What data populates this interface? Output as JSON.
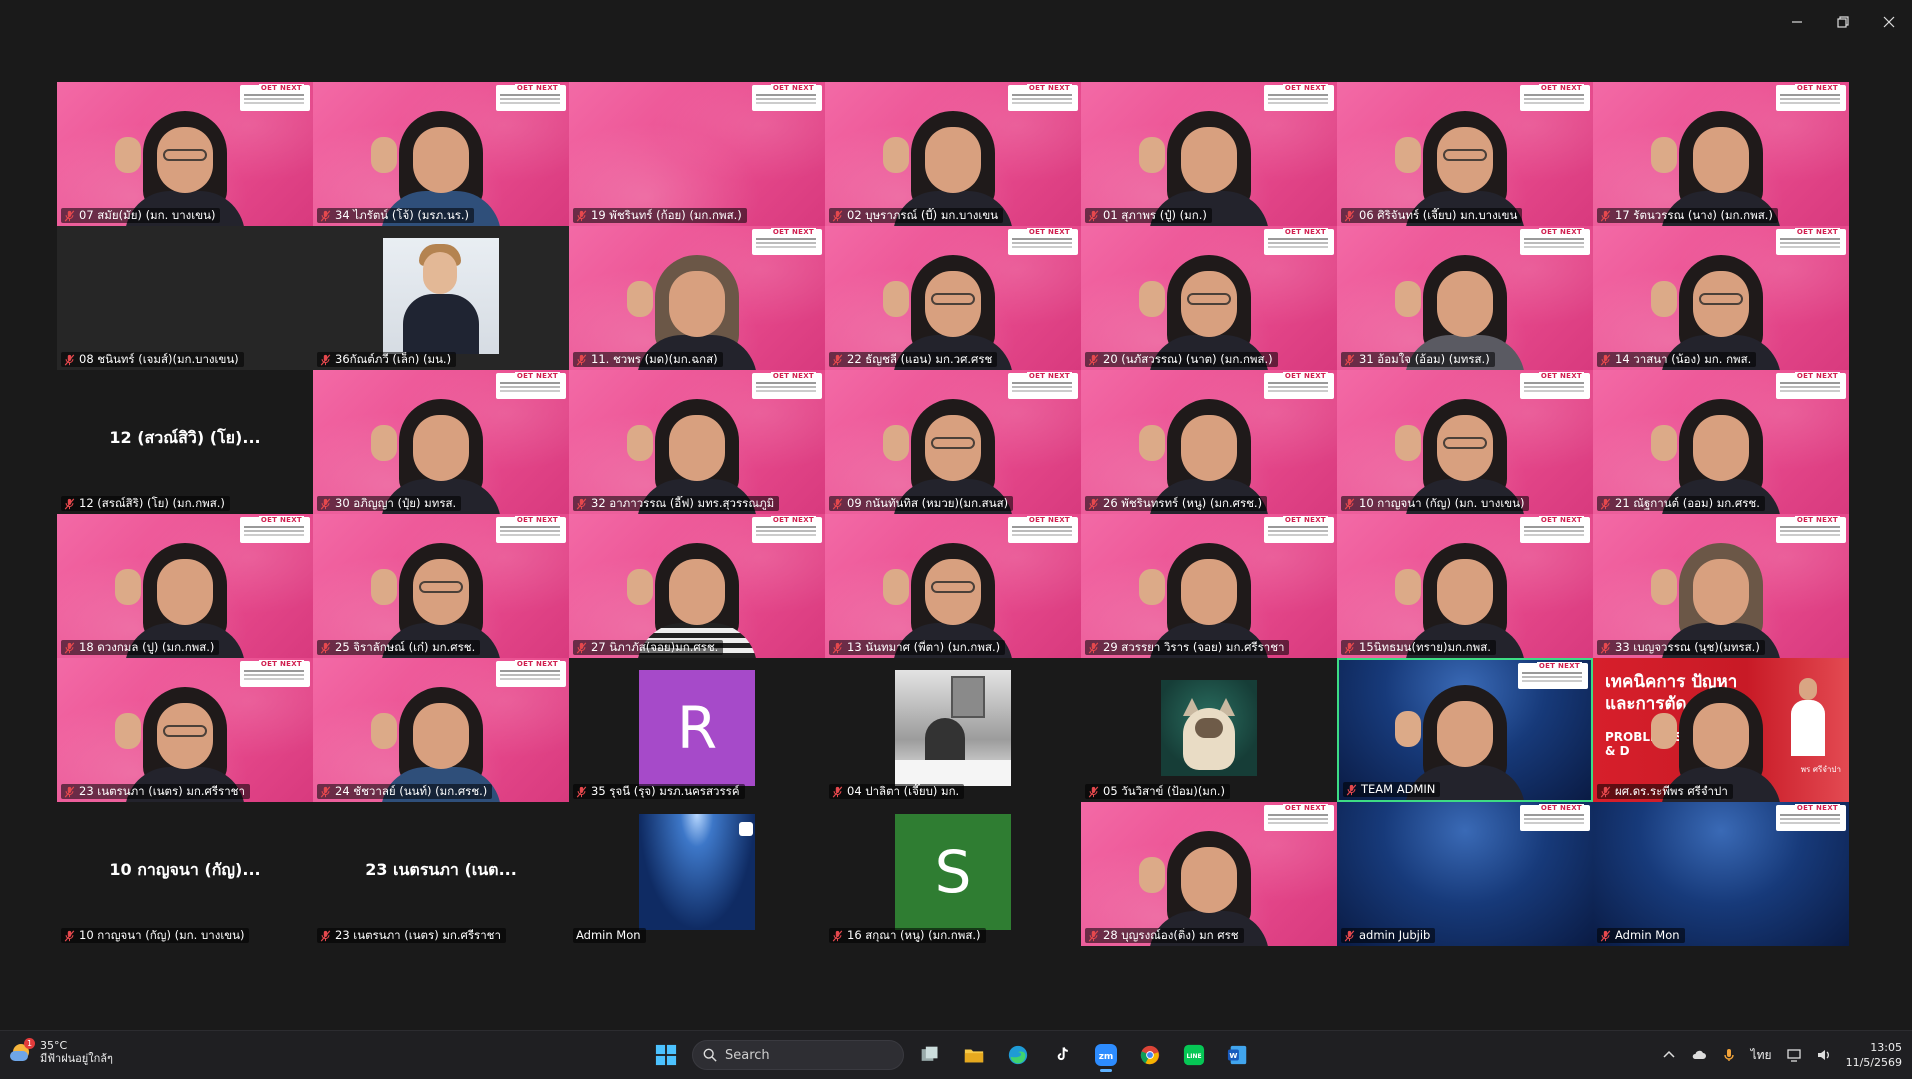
{
  "window": {
    "minimize": "minimize",
    "maximize": "restore",
    "close": "close"
  },
  "banner_logo": "OET NEXT",
  "tiles": [
    {
      "name": "07 สมัย(มัย) (มก. บางเขน)",
      "bg": "pink",
      "person": "glasses"
    },
    {
      "name": "34 ไภรัตน์ (โจ้) (มรภ.นร.)",
      "bg": "pink",
      "person": "blue-shirt"
    },
    {
      "name": "19 พัชรินทร์ (ก้อย) (มก.กพส.)",
      "bg": "pink",
      "person": "none"
    },
    {
      "name": "02 บุษราภรณ์ (บี๊) มก.บางเขน",
      "bg": "pink",
      "person": "plain"
    },
    {
      "name": "01 สุภาพร (ปู๋) (มก.)",
      "bg": "pink",
      "person": "plain"
    },
    {
      "name": "06 ศิริจันทร์ (เจี๊ยบ) มก.บางเขน",
      "bg": "pink",
      "person": "glasses"
    },
    {
      "name": "17 รัตนวรรณ (นาง) (มก.กพส.)",
      "bg": "pink",
      "person": "plain"
    },
    {
      "name": "08 ชนินทร์ (เจมส์)(มก.บางเขน)",
      "bg": "dark",
      "person": "none"
    },
    {
      "name": "36กัณต์ภวี (เล็ก) (มน.)",
      "bg": "dark",
      "avatar": "photo-man"
    },
    {
      "name": "11. ชวพร (มด)(มก.ฉกส)",
      "bg": "pink",
      "person": "light-hair"
    },
    {
      "name": "22  ธัญชลี (แอน) มก.วศ.ศรช",
      "bg": "pink",
      "person": "glasses"
    },
    {
      "name": "20 (นภัสวรรณ) (นาต) (มก.กพส.)",
      "bg": "pink",
      "person": "glasses"
    },
    {
      "name": "31 อ้อมใจ (อ้อม) (มทรส.)",
      "bg": "pink",
      "person": "gray-shirt"
    },
    {
      "name": "14 วาสนา (น้อง) มก. กพส.",
      "bg": "pink",
      "person": "glasses"
    },
    {
      "name": "12 (สรณ์สิริ) (โย) (มก.กพส.)",
      "bg": "black",
      "big": "12 (สวณ์สิวิ) (โย)..."
    },
    {
      "name": "30 อภิญญา (ปุ๋ย) มทรส.",
      "bg": "pink",
      "person": "plain"
    },
    {
      "name": "32 อาภาวรรณ (อี๊ฟ) มทร.สุวรรณภูมิ",
      "bg": "pink",
      "person": "plain"
    },
    {
      "name": "09 กนันทันทิส (หมวย)(มก.สนส)",
      "bg": "pink",
      "person": "glasses"
    },
    {
      "name": "26 พัชรินทรทร์ (หนู) (มก.ศรช.)",
      "bg": "pink",
      "person": "plain"
    },
    {
      "name": "10 กาญจนา (กัญ) (มก. บางเขน)",
      "bg": "pink",
      "person": "glasses"
    },
    {
      "name": "21 ณัฐกานต์ (ออม) มก.ศรช.",
      "bg": "pink",
      "person": "plain"
    },
    {
      "name": "18 ดวงกมล (ปู) (มก.กพส.)",
      "bg": "pink",
      "person": "plain"
    },
    {
      "name": "25 จิราลักษณ์ (เก๋) มก.ศรช.",
      "bg": "pink",
      "person": "glasses"
    },
    {
      "name": "27 นิภาภัส(จอย)มก.ศรช.",
      "bg": "pink",
      "person": "stripe"
    },
    {
      "name": "13 นันทมาศ (พี่ตา) (มก.กพส.)",
      "bg": "pink",
      "person": "glasses"
    },
    {
      "name": "29 สวรรยา วิราร (จอย) มก.ศรีราชา",
      "bg": "pink",
      "person": "plain"
    },
    {
      "name": "15นิทธมน(ทราย)มก.กพส.",
      "bg": "pink",
      "person": "plain"
    },
    {
      "name": "33 เบญจวรรณ (นุช)(มทรส.)",
      "bg": "pink",
      "person": "light-hair"
    },
    {
      "name": "23 เนตรนภา (เนตร) มก.ศรีราชา",
      "bg": "pink",
      "person": "glasses"
    },
    {
      "name": "24 ชัชวาลย์ (นนท์) (มก.ศรช.)",
      "bg": "pink",
      "person": "blue-shirt"
    },
    {
      "name": "35 รุจนี (รุจ) มรภ.นครสวรรค์",
      "bg": "black",
      "letter": "R",
      "letter_color": "#a64ac9"
    },
    {
      "name": "04 ปาลิตา (เจี๊ยบ) มก.",
      "bg": "black",
      "avatar": "photo-bw"
    },
    {
      "name": "05 วันวิสาข์ (ป้อม)(มก.)",
      "bg": "black",
      "avatar": "photo-cat"
    },
    {
      "name": "TEAM ADMIN",
      "bg": "blue",
      "person": "plain",
      "active": true
    },
    {
      "name": "ผศ.ดร.ระพีพร ศรีจำปา",
      "bg": "red",
      "red": true,
      "person": "plain"
    },
    {
      "name": "10 กาญจนา (กัญ) (มก. บางเขน)",
      "bg": "black",
      "big": "10 กาญจนา (กัญ)..."
    },
    {
      "name": "23 เนตรนภา (เนตร) มก.ศรีราชา",
      "bg": "black",
      "big": "23 เนตรนภา (เนต..."
    },
    {
      "name": "Admin Mon",
      "bg": "black",
      "avatar": "photo-space",
      "no_mic": true
    },
    {
      "name": "16 สกุณา (หนู) (มก.กพส.)",
      "bg": "black",
      "letter": "S",
      "letter_color": "#2f7d32"
    },
    {
      "name": "28 บุญรงณ์อง(ติ่ง) มก ศรช",
      "bg": "pink",
      "person": "plain"
    },
    {
      "name": "admin Jubjib",
      "bg": "blue",
      "person": "none"
    },
    {
      "name": "Admin Mon",
      "bg": "blue",
      "person": "none"
    }
  ],
  "red_slide": {
    "line1": "เทคนิคการ  ปัญหา",
    "line2": "และการตัด",
    "line3": "PROBLEM S",
    "line4": "& D",
    "website": "พร ศรีจำปา"
  },
  "taskbar": {
    "temp": "35°C",
    "weather_desc": "มีฟ้าฝนอยู่ใกล้ๆ",
    "weather_badge": "1",
    "search_placeholder": "Search",
    "lang": "ไทย",
    "time": "13:05",
    "date": "11/5/2569"
  },
  "colors": {
    "mic_off": "#e5484d",
    "active_border": "#3ddc84",
    "pink": "#e94b8e"
  }
}
